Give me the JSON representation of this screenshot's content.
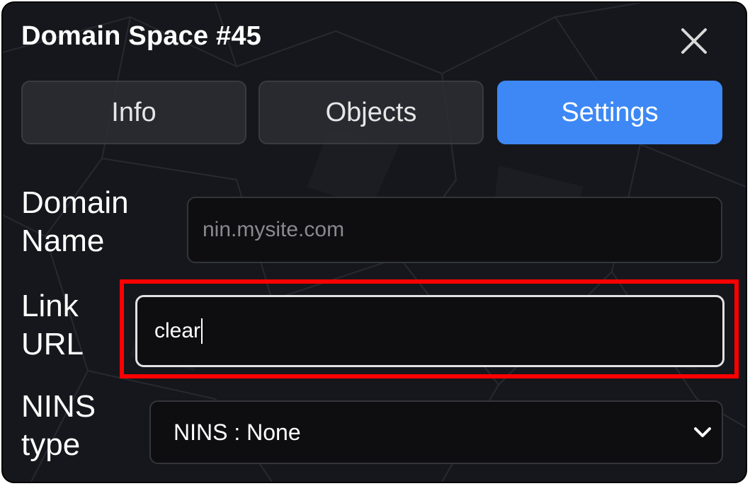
{
  "dialog": {
    "title": "Domain Space #45",
    "close_icon": "close-icon"
  },
  "tabs": [
    {
      "label": "Info",
      "active": false
    },
    {
      "label": "Objects",
      "active": false
    },
    {
      "label": "Settings",
      "active": true
    }
  ],
  "settings": {
    "domain_name": {
      "label_line1": "Domain",
      "label_line2": "Name",
      "placeholder": "nin.mysite.com",
      "value": ""
    },
    "link_url": {
      "label_line1": "Link",
      "label_line2": "URL",
      "value": "clear"
    },
    "nins_type": {
      "label_line1": "NINS",
      "label_line2": "type",
      "selected": "NINS : None",
      "dropdown_icon": "chevron-down-icon"
    }
  },
  "colors": {
    "accent": "#3d88f5",
    "panel_bg": "#16171c",
    "highlight": "#ff0000"
  }
}
